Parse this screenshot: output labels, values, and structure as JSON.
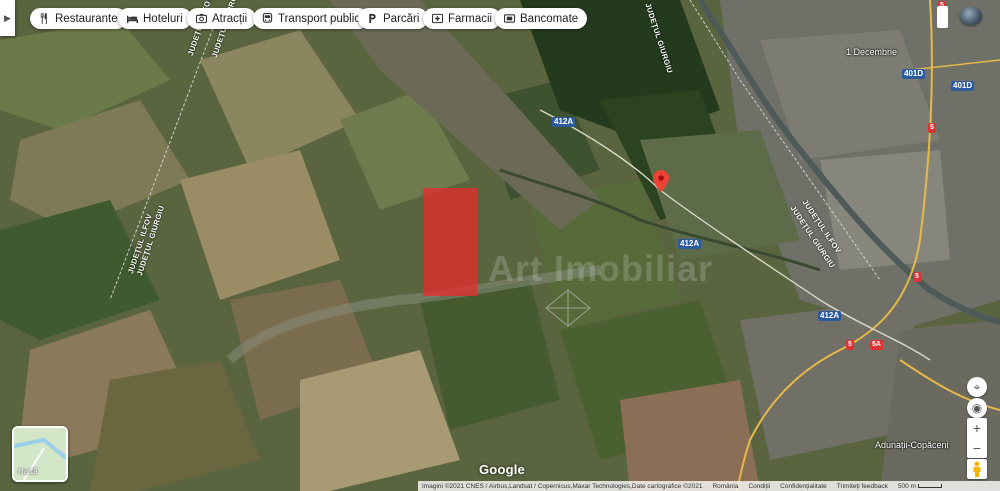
{
  "nav": {
    "collapse_icon": "chevron-right-icon"
  },
  "chips": [
    {
      "label": "Restaurante",
      "icon": "fork-knife-icon"
    },
    {
      "label": "Hoteluri",
      "icon": "bed-icon"
    },
    {
      "label": "Atracții",
      "icon": "camera-icon"
    },
    {
      "label": "Transport public",
      "icon": "bus-icon"
    },
    {
      "label": "Parcări",
      "icon": "parking-icon"
    },
    {
      "label": "Farmacii",
      "icon": "pharmacy-icon"
    },
    {
      "label": "Bancomate",
      "icon": "atm-icon"
    }
  ],
  "map_labels": {
    "place_1": "1 Decembrie",
    "place_2": "Adunații-Copăceni",
    "county_1": "JUDEȚUL ILFOV",
    "county_2": "JUDEȚUL GIURGIU",
    "county_3": "JUDEȚUL GIURGIU",
    "county_4": "JUDEȚUL ILFOV",
    "county_5": "JUDEȚUL ILFOV",
    "county_6": "JUDEȚUL GIURGIU",
    "county_7": "JUDEȚUL GIURGIU",
    "road_412a": "412A",
    "road_401d": "401D",
    "road_5": "5",
    "road_5a": "5A"
  },
  "watermark": "Art Imobiliar",
  "layer_toggle": {
    "label": "Hartă"
  },
  "brand": "Google",
  "footer": {
    "attribution": "Imagini ©2021 CNES / Airbus,Landsat / Copernicus,Maxar Technologies,Date cartografice ©2021",
    "country": "România",
    "terms": "Condiții",
    "privacy": "Confidențialitate",
    "feedback": "Trimiteți feedback",
    "scale": "500 m"
  },
  "colors": {
    "parcel": "#eb2828",
    "pin": "#ea4335"
  }
}
